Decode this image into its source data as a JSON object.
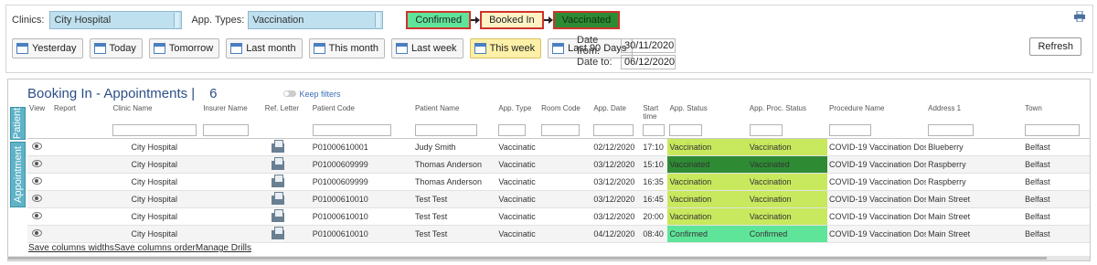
{
  "filters": {
    "clinics_label": "Clinics:",
    "clinics_value": "City Hospital",
    "app_types_label": "App. Types:",
    "app_types_value": "Vaccination"
  },
  "workflow": [
    "Confirmed",
    "Booked In",
    "Vaccinated"
  ],
  "workflow_colors": {
    "Confirmed": "#5fe59a",
    "Booked In": "#fff3c4",
    "Vaccinated": "#2e8b34"
  },
  "range_buttons": [
    "Yesterday",
    "Today",
    "Tomorrow",
    "Last month",
    "This month",
    "Last week",
    "This week",
    "Last 90 Days"
  ],
  "active_range": "This week",
  "date_from_label": "Date from:",
  "date_from": "30/11/2020",
  "date_to_label": "Date to:",
  "date_to": "06/12/2020",
  "refresh_label": "Refresh",
  "grid": {
    "title": "Booking In - Appointments |",
    "count": "6",
    "keep_filters": "Keep filters",
    "side_tabs": [
      "Patient",
      "Appointment"
    ],
    "columns": [
      "View",
      "Report",
      "Clinic Name",
      "Insurer Name",
      "Ref. Letter",
      "Patient Code",
      "Patient Name",
      "App. Type",
      "Room Code",
      "App. Date",
      "Start time",
      "App. Status",
      "App. Proc. Status",
      "Procedure Name",
      "Address 1",
      "Town"
    ],
    "rows": [
      {
        "clinic": "City Hospital",
        "code": "P01000610001",
        "name": "Judy Smith",
        "type": "Vaccinatic",
        "date": "02/12/2020",
        "time": "17:10",
        "status": "Vaccination",
        "proc": "Vaccination",
        "procedure": "COVID-19 Vaccination Dos",
        "address": "Blueberry",
        "town": "Belfast"
      },
      {
        "clinic": "City Hospital",
        "code": "P01000609999",
        "name": "Thomas Anderson",
        "type": "Vaccinatic",
        "date": "03/12/2020",
        "time": "15:10",
        "status": "Vaccinated",
        "proc": "Vaccinated",
        "procedure": "COVID-19 Vaccination Dos",
        "address": "Raspberry",
        "town": "Belfast"
      },
      {
        "clinic": "City Hospital",
        "code": "P01000609999",
        "name": "Thomas Anderson",
        "type": "Vaccinatic",
        "date": "03/12/2020",
        "time": "16:35",
        "status": "Vaccination",
        "proc": "Vaccination",
        "procedure": "COVID-19 Vaccination Dos",
        "address": "Raspberry",
        "town": "Belfast"
      },
      {
        "clinic": "City Hospital",
        "code": "P01000610010",
        "name": "Test Test",
        "type": "Vaccinatic",
        "date": "03/12/2020",
        "time": "16:45",
        "status": "Vaccination",
        "proc": "Vaccination",
        "procedure": "COVID-19 Vaccination Dos",
        "address": "Main Street",
        "town": "Belfast"
      },
      {
        "clinic": "City Hospital",
        "code": "P01000610010",
        "name": "Test Test",
        "type": "Vaccinatic",
        "date": "03/12/2020",
        "time": "20:00",
        "status": "Vaccination",
        "proc": "Vaccination",
        "procedure": "COVID-19 Vaccination Dos",
        "address": "Main Street",
        "town": "Belfast"
      },
      {
        "clinic": "City Hospital",
        "code": "P01000610010",
        "name": "Test Test",
        "type": "Vaccinatic",
        "date": "04/12/2020",
        "time": "08:40",
        "status": "Confirmed",
        "proc": "Confirmed",
        "procedure": "COVID-19 Vaccination Dos",
        "address": "Main Street",
        "town": "Belfast"
      }
    ],
    "footer_links": [
      "Save columns widths",
      "Save columns order",
      "Manage Drills"
    ]
  }
}
